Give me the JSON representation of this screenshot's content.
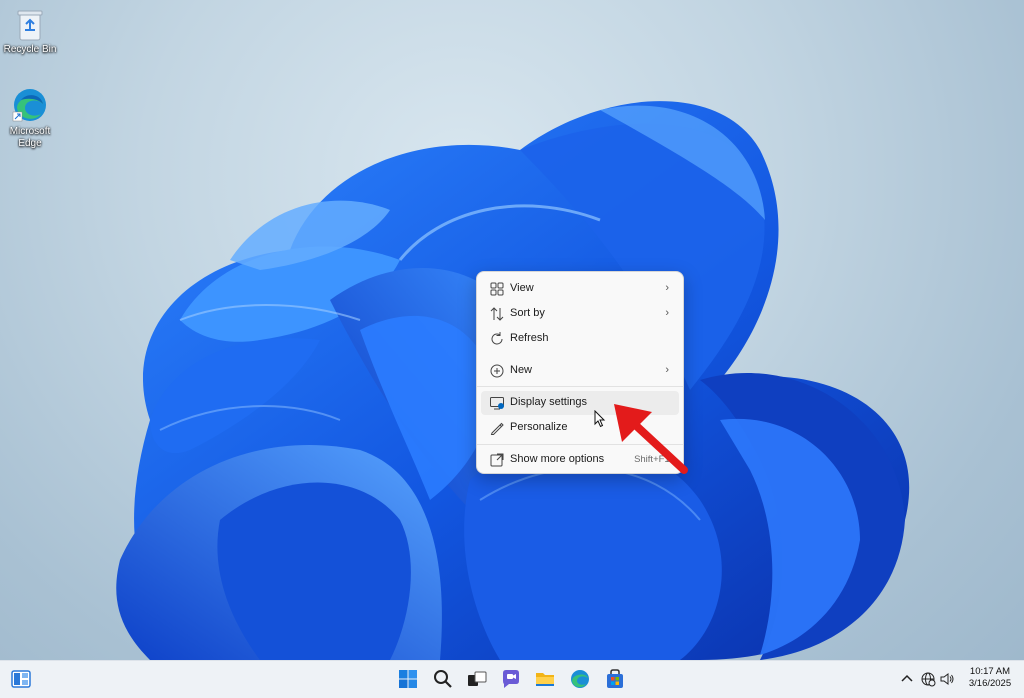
{
  "desktop": {
    "icons": [
      {
        "label": "Recycle Bin",
        "icon": "recycle-bin-icon"
      },
      {
        "label": "Microsoft\nEdge",
        "icon": "edge-icon"
      }
    ]
  },
  "context_menu": {
    "items": [
      {
        "label": "View",
        "icon": "view-grid-icon",
        "submenu": true
      },
      {
        "label": "Sort by",
        "icon": "sort-icon",
        "submenu": true
      },
      {
        "label": "Refresh",
        "icon": "refresh-icon",
        "submenu": false
      },
      {
        "label": "New",
        "icon": "plus-circle-icon",
        "submenu": true
      },
      {
        "label": "Display settings",
        "icon": "display-settings-icon",
        "submenu": false,
        "hovered": true
      },
      {
        "label": "Personalize",
        "icon": "pencil-icon",
        "submenu": false
      },
      {
        "label": "Show more options",
        "icon": "open-external-icon",
        "shortcut": "Shift+F10"
      }
    ]
  },
  "taskbar": {
    "left": [
      "widgets-icon"
    ],
    "center": [
      "start-icon",
      "search-icon",
      "task-view-icon",
      "chat-icon",
      "file-explorer-icon",
      "edge-icon",
      "store-icon"
    ],
    "tray": [
      "chevron-up-icon",
      "network-icon",
      "volume-icon"
    ],
    "time": "10:17 AM",
    "date": "3/16/2025"
  },
  "colors": {
    "accent": "#0067c0",
    "annotation_arrow": "#e31b1b"
  }
}
